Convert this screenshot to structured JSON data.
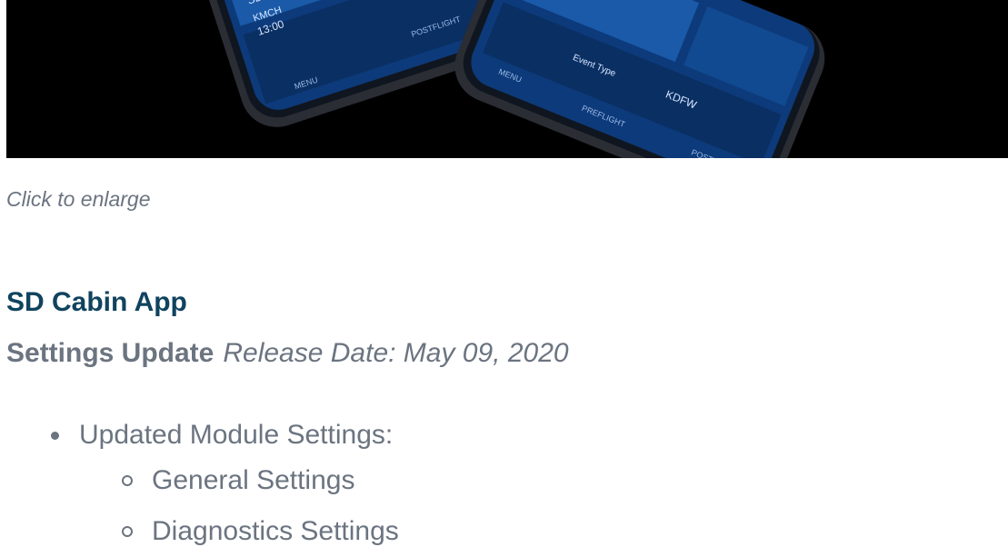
{
  "hero": {
    "image_name": "sd-cabin-app-phones-image"
  },
  "caption": "Click to enlarge",
  "app_title": "SD Cabin App",
  "update": {
    "label": "Settings Update",
    "release": "Release Date: May 09, 2020"
  },
  "list": {
    "item1": "Updated Module Settings:",
    "sub": [
      "General Settings",
      "Diagnostics Settings"
    ]
  },
  "colors": {
    "title": "#10435e",
    "text": "#6b7480",
    "phone_screen": "#0d3a7a",
    "hero_bg": "#000000"
  }
}
